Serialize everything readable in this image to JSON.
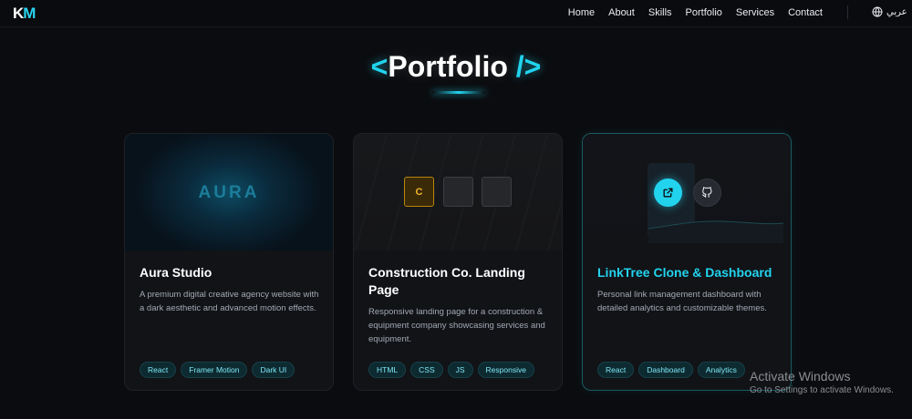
{
  "nav": {
    "logo_k": "K",
    "logo_m": "M",
    "links": [
      "Home",
      "About",
      "Skills",
      "Portfolio",
      "Services",
      "Contact"
    ],
    "language": "عربي",
    "language_icon": "globe-icon"
  },
  "section": {
    "open_bracket": "<",
    "title": "Portfolio",
    "close_bracket": "/>"
  },
  "projects": [
    {
      "thumb_text": "AURA",
      "title": "Aura Studio",
      "description": "A premium digital creative agency website with a dark aesthetic and advanced motion effects.",
      "tags": [
        "React",
        "Framer Motion",
        "Dark UI"
      ]
    },
    {
      "thumb_text": "C",
      "title": "Construction Co. Landing Page",
      "description": "Responsive landing page for a construction & equipment company showcasing services and equipment.",
      "tags": [
        "HTML",
        "CSS",
        "JS",
        "Responsive"
      ]
    },
    {
      "title": "LinkTree Clone & Dashboard",
      "description": "Personal link management dashboard with detailed analytics and customizable themes.",
      "tags": [
        "React",
        "Dashboard",
        "Analytics"
      ],
      "actions": [
        "external-link-icon",
        "github-icon"
      ]
    }
  ],
  "watermark": {
    "line1": "Activate Windows",
    "line2": "Go to Settings to activate Windows."
  },
  "colors": {
    "accent": "#22d3ee",
    "background": "#0b0c0f",
    "card": "#111317"
  }
}
